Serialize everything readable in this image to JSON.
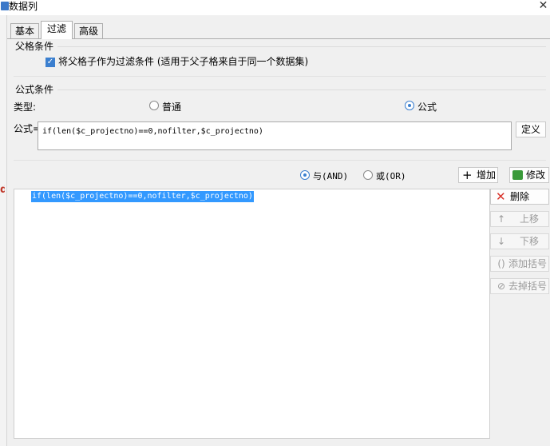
{
  "window": {
    "title": "数据列",
    "close_glyph": "✕"
  },
  "tabs": [
    {
      "label": "基本"
    },
    {
      "label": "过滤"
    },
    {
      "label": "高级"
    }
  ],
  "parent_cell": {
    "section_title": "父格条件",
    "checkbox_label": "将父格子作为过滤条件 (适用于父子格来自于同一个数据集)",
    "checked": true
  },
  "formula_condition": {
    "section_title": "公式条件",
    "type_label": "类型:",
    "option_normal": "普通",
    "option_formula": "公式",
    "selected": "公式",
    "formula_label": "公式=",
    "formula_value": "if(len($c_projectno)==0,nofilter,$c_projectno)",
    "define_button": "定义"
  },
  "join": {
    "and_label": "与(AND)",
    "or_label": "或(OR)",
    "selected": "与(AND)",
    "add_button": "增加",
    "modify_button": "修改"
  },
  "condition_list": {
    "items": [
      "if(len($c_projectno)==0,nofilter,$c_projectno)"
    ]
  },
  "side_buttons": {
    "delete": "删除",
    "up": "上移",
    "down": "下移",
    "add_bracket": "添加括号",
    "remove_bracket": "去掉括号"
  },
  "colors": {
    "accent": "#3b7fcf",
    "selection": "#3399ff",
    "delete_red": "#d9322a",
    "modify_green": "#3a9a3a"
  }
}
